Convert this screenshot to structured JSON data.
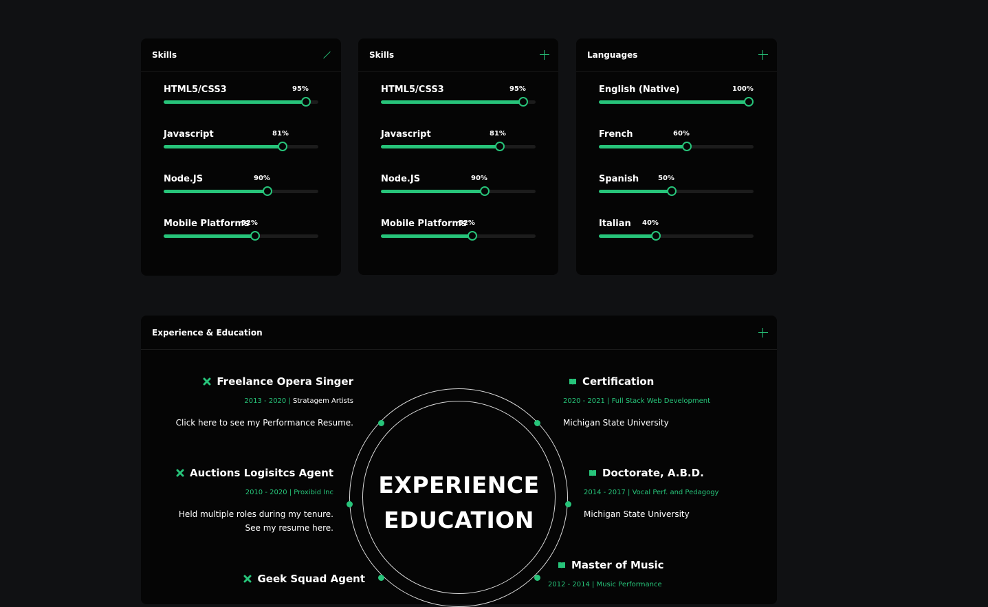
{
  "cards": [
    {
      "title": "Skills",
      "action_icon": "collapse-icon",
      "items": [
        {
          "name": "HTML5/CSS3",
          "pct_label": "95%",
          "value": 0.92
        },
        {
          "name": "Javascript",
          "pct_label": "81%",
          "value": 0.77
        },
        {
          "name": "Node.JS",
          "pct_label": "90%",
          "value": 0.67
        },
        {
          "name": "Mobile Platforms",
          "pct_label": "52%",
          "value": 0.59
        }
      ]
    },
    {
      "title": "Skills",
      "action_icon": "plus-icon",
      "items": [
        {
          "name": "HTML5/CSS3",
          "pct_label": "95%",
          "value": 0.92
        },
        {
          "name": "Javascript",
          "pct_label": "81%",
          "value": 0.77
        },
        {
          "name": "Node.JS",
          "pct_label": "90%",
          "value": 0.67
        },
        {
          "name": "Mobile Platforms",
          "pct_label": "52%",
          "value": 0.59
        }
      ]
    },
    {
      "title": "Languages",
      "action_icon": "plus-icon",
      "items": [
        {
          "name": "English (Native)",
          "pct_label": "100%",
          "value": 0.97
        },
        {
          "name": "French",
          "pct_label": "60%",
          "value": 0.57
        },
        {
          "name": "Spanish",
          "pct_label": "50%",
          "value": 0.47
        },
        {
          "name": "Italian",
          "pct_label": "40%",
          "value": 0.37
        }
      ]
    }
  ],
  "experience": {
    "title": "Experience & Education",
    "center_line1": "EXPERIENCE",
    "center_line2": "EDUCATION",
    "left": [
      {
        "title": "Freelance Opera Singer",
        "icon": "tools-icon",
        "years": "2013 - 2020 |",
        "org": "Stratagem Artists",
        "desc1": "Click here to see my Performance Resume.",
        "desc2": ""
      },
      {
        "title": "Auctions Logisitcs Agent",
        "icon": "tools-icon",
        "years": "2010 - 2020 | Proxibid Inc",
        "org": "",
        "desc1": "Held multiple roles during my tenure.",
        "desc2": "See my resume here."
      },
      {
        "title": "Geek Squad Agent",
        "icon": "tools-icon",
        "years": "",
        "org": "",
        "desc1": "",
        "desc2": ""
      }
    ],
    "right": [
      {
        "title": "Certification",
        "icon": "book-icon",
        "years": "2020 - 2021 | Full Stack Web Development",
        "desc1": "Michigan State University"
      },
      {
        "title": "Doctorate, A.B.D.",
        "icon": "book-icon",
        "years": "2014 - 2017 | Vocal Perf. and Pedagogy",
        "desc1": "Michigan State University"
      },
      {
        "title": "Master of Music",
        "icon": "book-icon",
        "years": "2012 - 2014 | Music Performance",
        "desc1": ""
      }
    ]
  },
  "colors": {
    "accent": "#27c47a",
    "background": "#101113",
    "card": "#050505"
  }
}
